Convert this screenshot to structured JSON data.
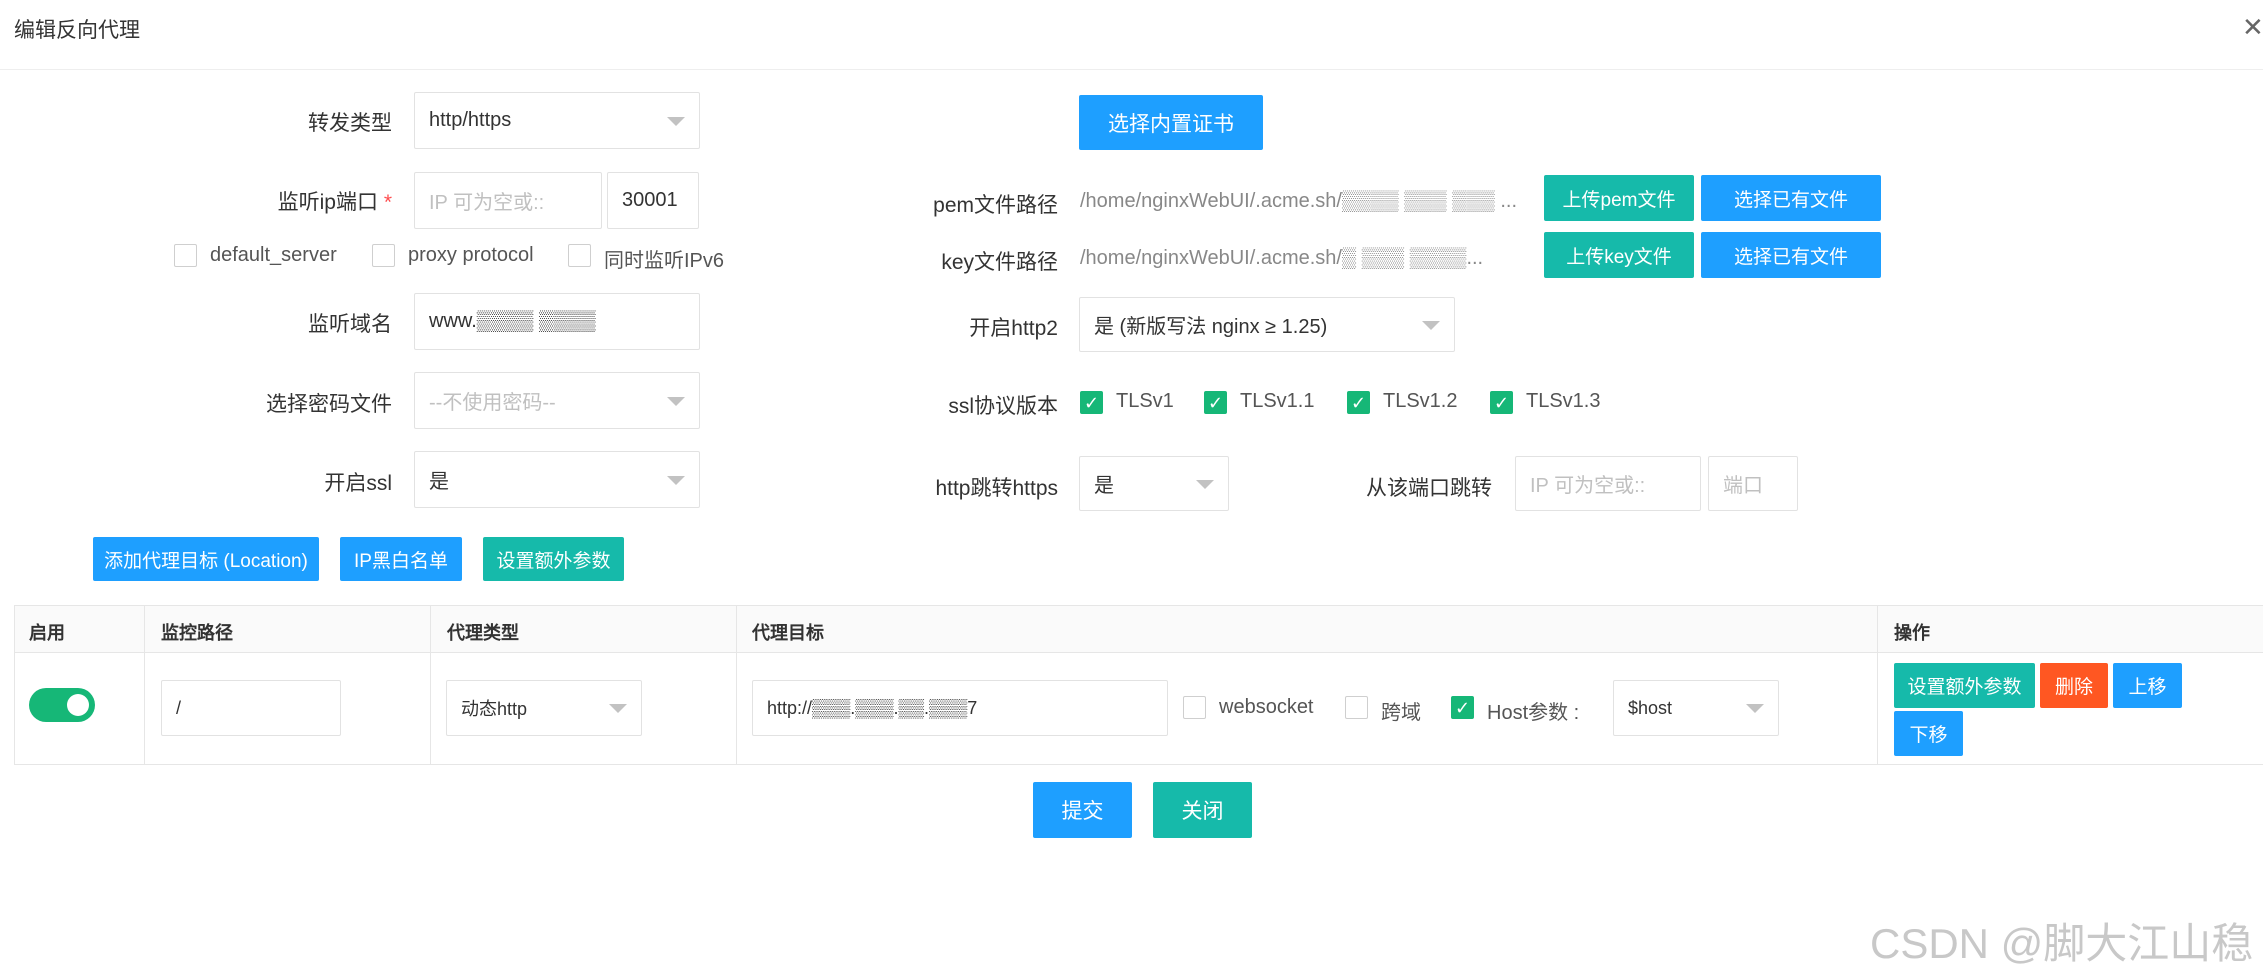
{
  "dialog": {
    "title": "编辑反向代理",
    "close_icon": "close-icon"
  },
  "left_form": {
    "forward_type_label": "转发类型",
    "forward_type_value": "http/https",
    "listen_label": "监听ip端口",
    "listen_required": "*",
    "listen_ip_placeholder": "IP 可为空或::",
    "listen_port_value": "30001",
    "opt_default_server": "default_server",
    "opt_proxy_protocol": "proxy protocol",
    "opt_ipv6": "同时监听IPv6",
    "domain_label": "监听域名",
    "domain_value": "www.▒▒▒▒ ▒▒▒▒",
    "password_label": "选择密码文件",
    "password_value": "--不使用密码--",
    "ssl_label": "开启ssl",
    "ssl_value": "是"
  },
  "right_form": {
    "select_builtin_cert": "选择内置证书",
    "pem_label": "pem文件路径",
    "pem_value": "/home/nginxWebUI/.acme.sh/▒▒▒▒ ▒▒▒ ▒▒▒ ...",
    "upload_pem": "上传pem文件",
    "choose_existing_1": "选择已有文件",
    "key_label": "key文件路径",
    "key_value": "/home/nginxWebUI/.acme.sh/▒ ▒▒▒ ▒▒▒▒...",
    "upload_key": "上传key文件",
    "choose_existing_2": "选择已有文件",
    "http2_label": "开启http2",
    "http2_value": "是 (新版写法 nginx ≥ 1.25)",
    "ssl_proto_label": "ssl协议版本",
    "tls": [
      "TLSv1",
      "TLSv1.1",
      "TLSv1.2",
      "TLSv1.3"
    ],
    "redirect_label": "http跳转https",
    "redirect_value": "是",
    "redirect_port_label": "从该端口跳转",
    "redirect_ip_placeholder": "IP 可为空或::",
    "redirect_port_placeholder": "端口"
  },
  "actions": {
    "add_location": "添加代理目标 (Location)",
    "ip_blacklist": "IP黑白名单",
    "extra_params": "设置额外参数"
  },
  "table": {
    "headers": [
      "启用",
      "监控路径",
      "代理类型",
      "代理目标",
      "操作"
    ],
    "row": {
      "path": "/",
      "proxy_type": "动态http",
      "target": "http://▒▒▒.▒▒▒.▒▒.▒▒▒7",
      "websocket": "websocket",
      "cors": "跨域",
      "host_param": "Host参数 :",
      "host_value": "$host",
      "btn_extra": "设置额外参数",
      "btn_delete": "删除",
      "btn_up": "上移",
      "btn_down": "下移"
    }
  },
  "footer": {
    "submit": "提交",
    "close": "关闭"
  },
  "watermark": "CSDN @脚大江山稳",
  "colors": {
    "blue": "#1e9fff",
    "teal": "#16baaa",
    "green": "#16b777",
    "red": "#ff5722"
  }
}
